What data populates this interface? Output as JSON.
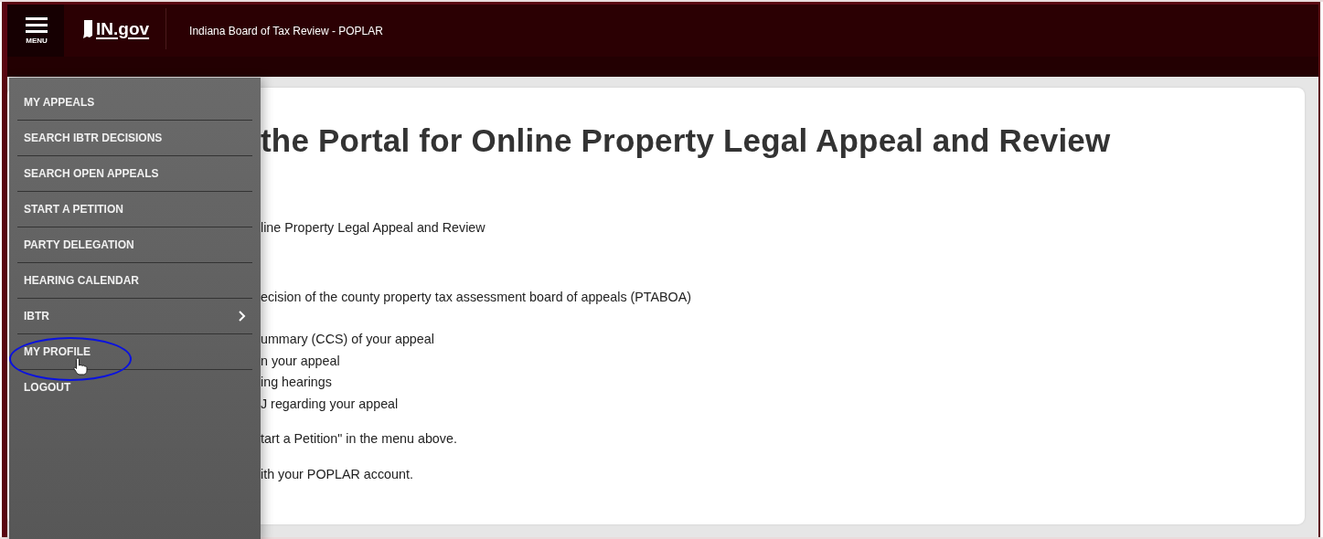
{
  "header": {
    "menu_label": "MENU",
    "logo": "IN.gov",
    "site_title": "Indiana Board of Tax Review - POPLAR"
  },
  "menu": {
    "items": [
      {
        "label": "MY APPEALS",
        "has_submenu": false
      },
      {
        "label": "SEARCH IBTR DECISIONS",
        "has_submenu": false
      },
      {
        "label": "SEARCH OPEN APPEALS",
        "has_submenu": false
      },
      {
        "label": "START A PETITION",
        "has_submenu": false
      },
      {
        "label": "PARTY DELEGATION",
        "has_submenu": false
      },
      {
        "label": "HEARING CALENDAR",
        "has_submenu": false
      },
      {
        "label": "IBTR",
        "has_submenu": true
      },
      {
        "label": "MY PROFILE",
        "has_submenu": false
      },
      {
        "label": "LOGOUT",
        "has_submenu": false
      }
    ]
  },
  "content": {
    "heading": "the Portal for Online Property Legal Appeal and Review",
    "blocks": [
      [
        "line Property Legal Appeal and Review"
      ],
      [
        "ecision of the county property tax assessment board of appeals (PTABOA)"
      ],
      [
        "ummary (CCS) of your appeal",
        "n your appeal",
        "ing hearings",
        "J regarding your appeal"
      ],
      [
        "tart a Petition\" in the menu above."
      ],
      [
        "ith your POPLAR account."
      ]
    ]
  }
}
